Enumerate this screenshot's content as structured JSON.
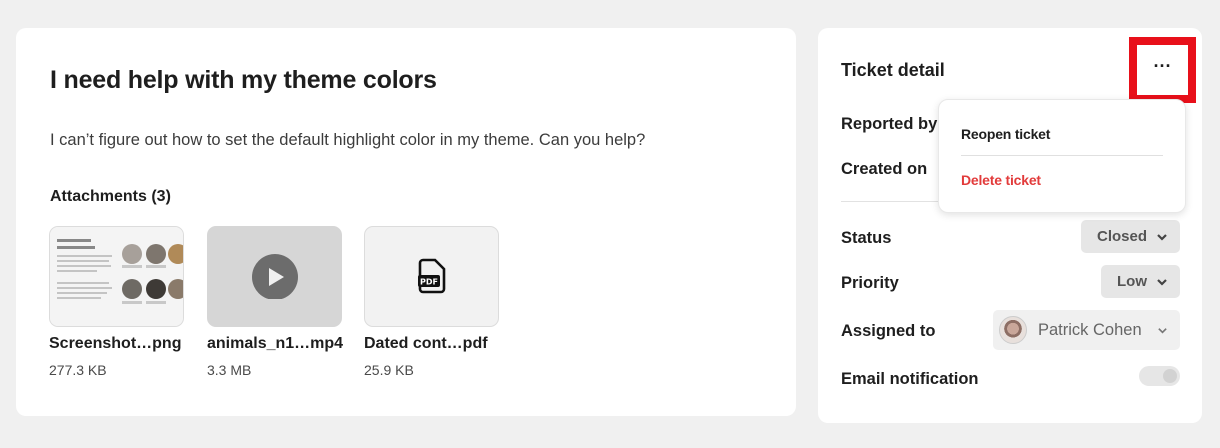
{
  "ticket": {
    "title": "I need help with my theme colors",
    "body": "I can’t figure out how to set the default highlight color in my theme. Can you help?"
  },
  "attachments": {
    "heading": "Attachments (3)",
    "items": [
      {
        "name": "Screenshot…png",
        "size": "277.3 KB",
        "kind": "image"
      },
      {
        "name": "animals_n1…mp4",
        "size": "3.3 MB",
        "kind": "video"
      },
      {
        "name": "Dated cont…pdf",
        "size": "25.9 KB",
        "kind": "pdf"
      }
    ]
  },
  "detail": {
    "title": "Ticket detail",
    "reported_by_label": "Reported by",
    "created_on_label": "Created on",
    "status_label": "Status",
    "status_value": "Closed",
    "priority_label": "Priority",
    "priority_value": "Low",
    "assigned_label": "Assigned to",
    "assigned_value": "Patrick Cohen",
    "email_label": "Email notification",
    "email_enabled": false
  },
  "menu": {
    "button_icon": "more-horizontal-icon",
    "reopen": "Reopen ticket",
    "delete": "Delete ticket"
  },
  "colors": {
    "highlight": "#e8101a",
    "danger": "#e23b3b"
  }
}
